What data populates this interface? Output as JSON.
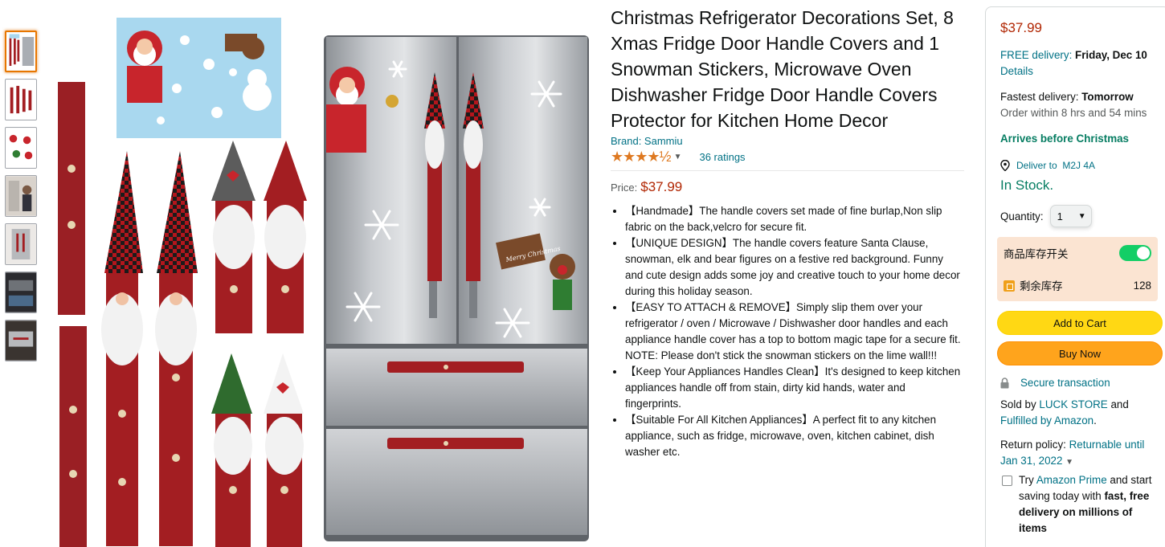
{
  "thumbnails": [
    {
      "name": "thumb-1",
      "active": true
    },
    {
      "name": "thumb-2",
      "active": false
    },
    {
      "name": "thumb-3",
      "active": false
    },
    {
      "name": "thumb-4",
      "active": false
    },
    {
      "name": "thumb-5",
      "active": false
    },
    {
      "name": "thumb-6",
      "active": false
    },
    {
      "name": "thumb-7",
      "active": false
    }
  ],
  "image_text": {
    "sign": "Merry Christmas"
  },
  "product": {
    "title": "Christmas Refrigerator Decorations Set, 8 Xmas Fridge Door Handle Covers and 1 Snowman Stickers, Microwave Oven Dishwasher Fridge Door Handle Covers Protector for Kitchen Home Decor",
    "brand": "Brand: Sammiu",
    "stars": "★★★★½",
    "ratings": "36 ratings",
    "price_label": "Price:",
    "price": "$37.99",
    "bullets": [
      "【Handmade】The handle covers set made of fine burlap,Non slip fabric on the back,velcro for secure fit.",
      "【UNIQUE DESIGN】The handle covers feature Santa Clause, snowman, elk and bear figures on a festive red background. Funny and cute design adds some joy and creative touch to your home decor during this holiday season.",
      "【EASY TO ATTACH & REMOVE】Simply slip them over your refrigerator / oven / Microwave / Dishwasher door handles and each appliance handle cover has a top to bottom magic tape for a secure fit. NOTE: Please don't stick the snowman stickers on the lime wall!!!",
      "【Keep Your Appliances Handles Clean】It's designed to keep kitchen appliances handle off from stain, dirty kid hands, water and fingerprints.",
      "【Suitable For All Kitchen Appliances】A perfect fit to any kitchen appliance, such as fridge, microwave, oven, kitchen cabinet, dish washer etc."
    ]
  },
  "buybox": {
    "price": "$37.99",
    "free_delivery_link": "FREE delivery:",
    "free_delivery_date": "Friday, Dec 10",
    "details_link": "Details",
    "fastest_label": "Fastest delivery:",
    "fastest_value": "Tomorrow",
    "order_within": "Order within 8 hrs and 54 mins",
    "arrives": "Arrives before Christmas",
    "deliver_to": "Deliver to",
    "postal": "M2J 4A",
    "in_stock": "In Stock.",
    "quantity_label": "Quantity:",
    "quantity_value": "1",
    "stock_switch_label": "商品库存开关",
    "remaining_label": "剩余库存",
    "remaining_value": "128",
    "add_to_cart": "Add to Cart",
    "buy_now": "Buy Now",
    "secure": "Secure transaction",
    "sold_by_prefix": "Sold by",
    "seller": "LUCK STORE",
    "sold_by_and": "and",
    "fulfilled": "Fulfilled by Amazon",
    "period": ".",
    "return_label": "Return policy:",
    "return_link": "Returnable until Jan 31, 2022",
    "prime_try": "Try",
    "prime_link": "Amazon Prime",
    "prime_rest": "and start saving today with",
    "prime_bold": "fast, free delivery on millions of items"
  },
  "colors": {
    "accent_link": "#007185",
    "price_red": "#b12704",
    "star_orange": "#de7921",
    "cart_yellow": "#ffd814",
    "buy_orange": "#ffa41c",
    "stock_green": "#067d62"
  }
}
